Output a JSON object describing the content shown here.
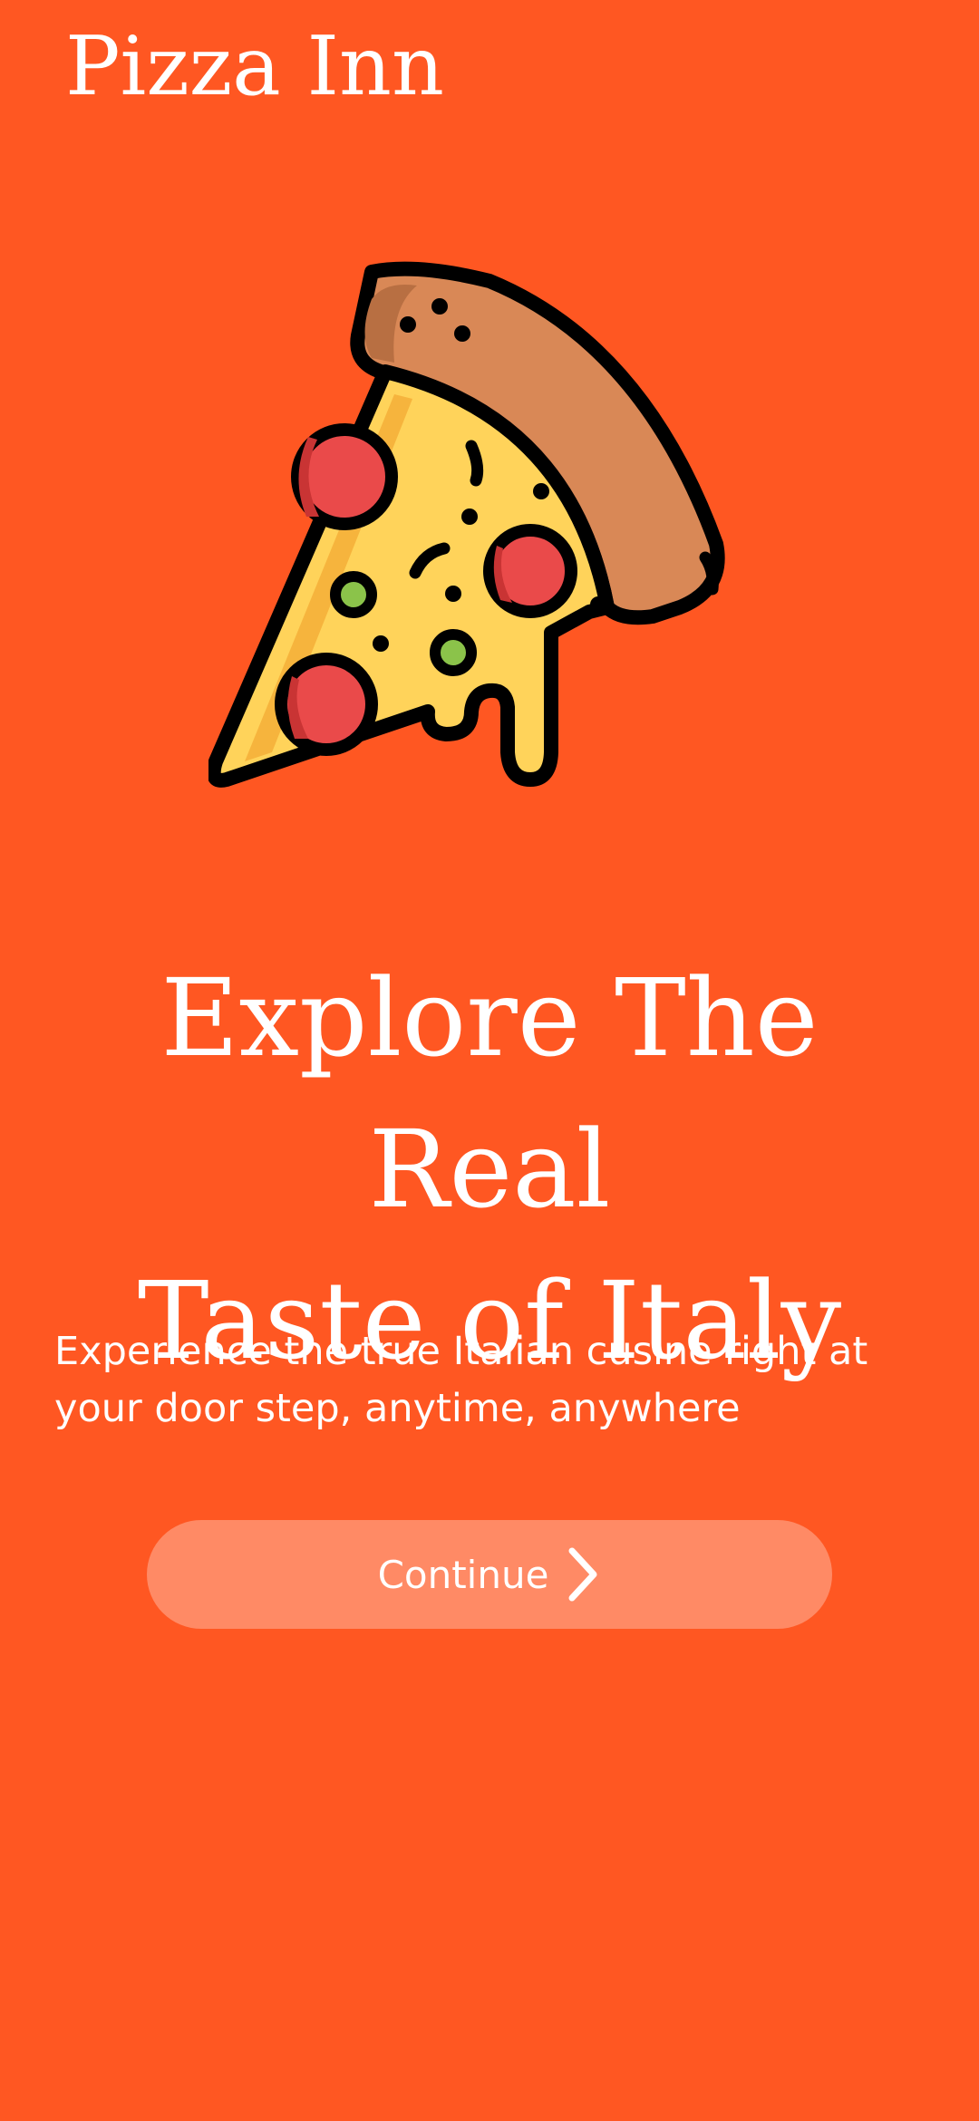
{
  "app": {
    "title": "Pizza Inn"
  },
  "hero": {
    "icon": "pizza-slice-icon",
    "headline_line1": "Explore The Real",
    "headline_line2": "Taste of Italy",
    "tagline": "Experience the true Italian cusine right at your door step, anytime, anywhere"
  },
  "cta": {
    "label": "Continue",
    "icon": "chevron-right-icon"
  },
  "colors": {
    "background": "#FF5722",
    "button": "#FF8A65",
    "text": "#FFFFFF"
  }
}
